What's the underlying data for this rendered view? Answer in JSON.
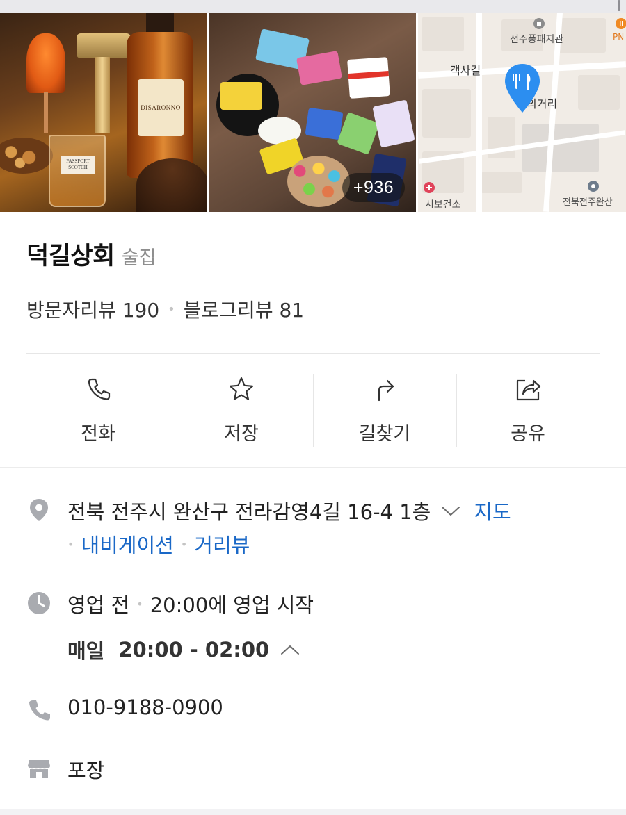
{
  "gallery": {
    "photo_1_text": {
      "bottle_label": "DISARONNO",
      "glass_label": "PASSPORT SCOTCH"
    },
    "more_photos_count": "+936",
    "map": {
      "labels": [
        "전주풍패지관",
        "객사길",
        "의거리",
        "시보건소",
        "전북전주완산",
        "PN"
      ],
      "pin_icon": "restaurant-pin-icon"
    }
  },
  "place": {
    "name": "덕길상회",
    "category": "술집",
    "visitor_reviews": "방문자리뷰 190",
    "blog_reviews": "블로그리뷰 81"
  },
  "actions": [
    {
      "label": "전화",
      "icon": "phone-icon"
    },
    {
      "label": "저장",
      "icon": "star-icon"
    },
    {
      "label": "길찾기",
      "icon": "directions-icon"
    },
    {
      "label": "공유",
      "icon": "share-icon"
    }
  ],
  "info": {
    "address": "전북 전주시 완산구 전라감영4길 16-4 1층",
    "map_link": "지도",
    "navigation_link": "내비게이션",
    "street_view_link": "거리뷰",
    "status": "영업 전",
    "status_detail": "20:00에 영업 시작",
    "days": "매일",
    "hours": "20:00 - 02:00",
    "phone": "010-9188-0900",
    "service": "포장"
  },
  "colors": {
    "link": "#1a68c7",
    "icon_gray": "#a9abb0",
    "pin_blue": "#2c8ef0"
  }
}
